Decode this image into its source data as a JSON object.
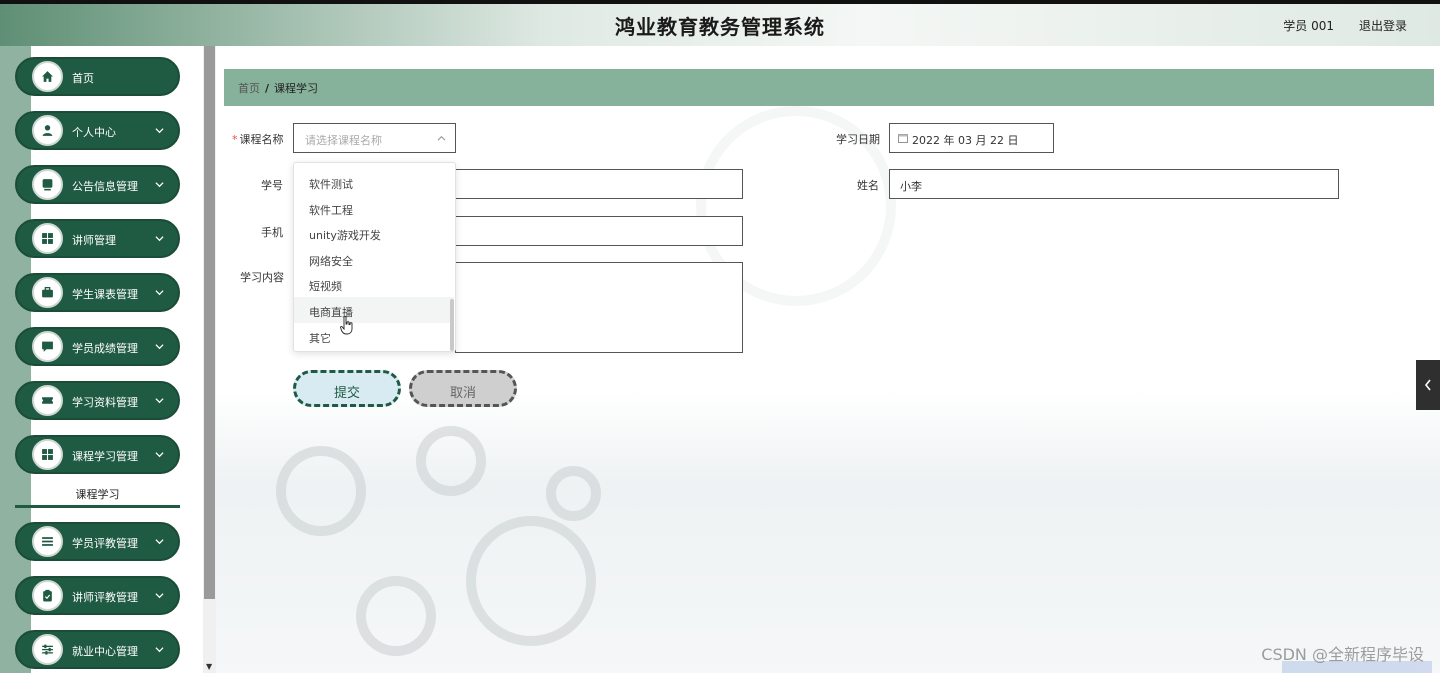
{
  "header": {
    "title": "鸿业教育教务管理系统",
    "user": "学员 001",
    "logout": "退出登录"
  },
  "sidebar": {
    "items": [
      {
        "label": "首页",
        "icon": "home-icon"
      },
      {
        "label": "个人中心",
        "icon": "user-icon"
      },
      {
        "label": "公告信息管理",
        "icon": "notice-icon"
      },
      {
        "label": "讲师管理",
        "icon": "grid-icon"
      },
      {
        "label": "学生课表管理",
        "icon": "briefcase-icon"
      },
      {
        "label": "学员成绩管理",
        "icon": "chat-icon"
      },
      {
        "label": "学习资料管理",
        "icon": "ticket-icon"
      },
      {
        "label": "课程学习管理",
        "icon": "grid-icon"
      },
      {
        "label": "学员评教管理",
        "icon": "list-icon"
      },
      {
        "label": "讲师评教管理",
        "icon": "clipboard-icon"
      },
      {
        "label": "就业中心管理",
        "icon": "sliders-icon"
      }
    ],
    "active_sub": "课程学习"
  },
  "breadcrumb": {
    "home": "首页",
    "separator": "/",
    "current": "课程学习"
  },
  "form": {
    "course_label": "课程名称",
    "course_placeholder": "请选择课程名称",
    "date_label": "学习日期",
    "date_value": "2022 年 03 月 22 日",
    "student_id_label": "学号",
    "name_label": "姓名",
    "name_value": "小李",
    "phone_label": "手机",
    "content_label": "学习内容",
    "submit": "提交",
    "cancel": "取消"
  },
  "dropdown": {
    "options": [
      "软件测试",
      "软件工程",
      "unity游戏开发",
      "网络安全",
      "短视频",
      "电商直播",
      "其它"
    ],
    "hovered": "电商直播"
  },
  "watermark": "CSDN @全新程序毕设"
}
